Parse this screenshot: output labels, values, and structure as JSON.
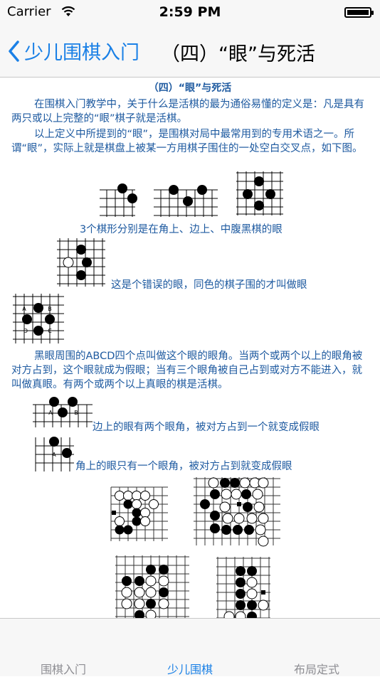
{
  "status_bar": {
    "carrier": "Carrier",
    "time": "2:59 PM"
  },
  "nav": {
    "back_label": "少儿围棋入门",
    "title": "（四）“眼”与死活"
  },
  "content": {
    "title": "（四）“眼”与死活",
    "para1": "在围棋入门教学中，关于什么是活棋的最为通俗易懂的定义是：凡是具有两只或以上完整的“眼”棋子就是活棋。",
    "para2": "以上定义中所提到的“眼”，是围棋对局中最常用到的专用术语之一。所谓“眼”，实际上就是棋盘上被某一方用棋子围住的一处空白交叉点，如下图。",
    "cap1": "3个棋形分别是在角上、边上、中腹黑棋的眼",
    "cap2": "这是个错误的眼，同色的棋子围的才叫做眼",
    "para3": "黑眼周围的ABCD四个点叫做这个眼的眼角。当两个或两个以上的眼角被对方占到，这个眼就成为假眼；当有三个眼角被自己占到或对方不能进入，就叫做真眼。有两个或两个以上真眼的棋是活棋。",
    "cap3": "边上的眼有两个眼角，被对方占到一个就变成假眼",
    "cap4": "角上的眼只有一个眼角，被对方占到就变成假眼",
    "diagram_letters": {
      "a": "A",
      "b": "B",
      "c": "C",
      "d": "D"
    }
  },
  "tabs": [
    {
      "label": "围棋入门",
      "active": false
    },
    {
      "label": "少儿围棋",
      "active": true
    },
    {
      "label": "布局定式",
      "active": false
    }
  ],
  "colors": {
    "accent": "#1a80e6",
    "text_blue": "#1e5aa0",
    "bar_bg": "#f7f7f7"
  }
}
